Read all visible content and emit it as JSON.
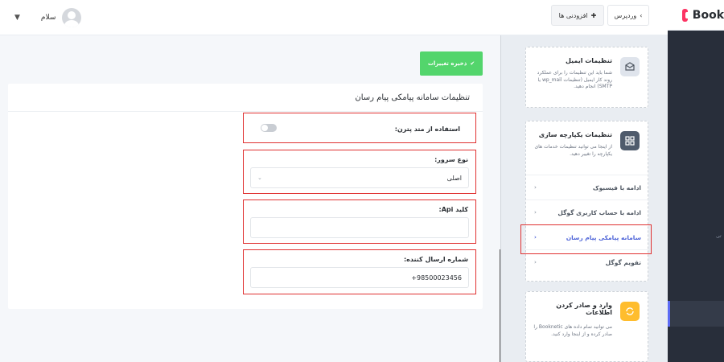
{
  "topbar": {
    "user_greeting": "سلام",
    "addons_label": "افزودنی ها",
    "wordpress_label": "وردپرس"
  },
  "brand": {
    "name": "Book"
  },
  "darkbar": {
    "tiny_text": "تی"
  },
  "save_button": {
    "label": "ذخیره تغییرات"
  },
  "form": {
    "title": "تنظیمات سامانه پیامکی پیام رسان",
    "pattern_label": "استفاده از متد پترن:",
    "server_type_label": "نوع سرور:",
    "server_type_value": "اصلی",
    "api_key_label": "کلید Api:",
    "api_key_value": "",
    "sender_label": "شماره ارسال کننده:",
    "sender_value": "+98500023456"
  },
  "side": {
    "email_title": "تنظیمات ایمیل",
    "email_desc": "شما باید این تنظیمات را برای عملکرد روند کار ایمیل (تنظیمات wp_mail یا SMTP) انجام دهید.",
    "integ_title": "تنظیمات یکپارچه سازی",
    "integ_desc": "از اینجا می توانید تنظیمات خدمات های یکپارچه را تغییر دهید.",
    "integ_items": [
      {
        "label": "ادامه با فیسبوک"
      },
      {
        "label": "ادامه با حساب کاربری گوگل"
      },
      {
        "label": "سامانه پیامکی پیام رسان"
      },
      {
        "label": "تقویم گوگل"
      }
    ],
    "import_title": "وارد و صادر کردن اطلاعات",
    "import_desc": "می توانید تمام داده های Booknetic را صادر کرده و از اینجا وارد کنید."
  },
  "colors": {
    "accent": "#4f65d8",
    "save_green": "#53d56c",
    "highlight_red": "#e03131",
    "dark_sidebar": "#282e3a"
  }
}
